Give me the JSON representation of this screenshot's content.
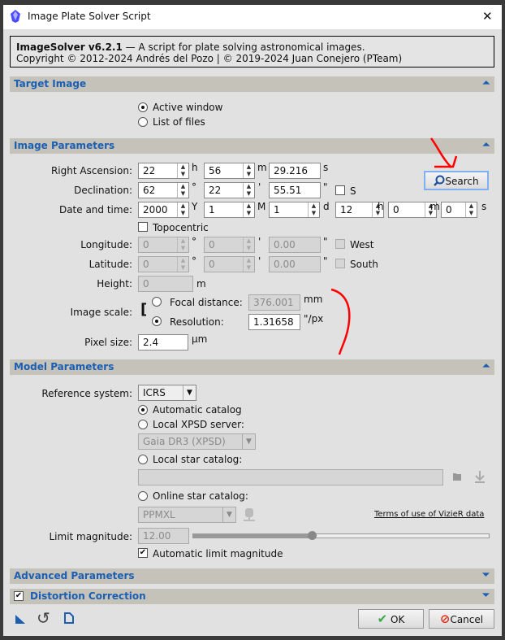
{
  "window": {
    "title": "Image Plate Solver Script",
    "close": "✕"
  },
  "header": {
    "app": "ImageSolver v6.2.1",
    "desc": " — A script for plate solving astronomical images.",
    "copyright": "Copyright © 2012-2024 Andrés del Pozo | © 2019-2024 Juan Conejero (PTeam)"
  },
  "target": {
    "title": "Target Image",
    "active": "Active window",
    "list": "List of files",
    "active_selected": true
  },
  "image": {
    "title": "Image Parameters",
    "ra": {
      "label": "Right Ascension:",
      "h": "22",
      "m": "56",
      "s": "29.216",
      "uh": "h",
      "um": "m",
      "us": "s"
    },
    "dec": {
      "label": "Declination:",
      "d": "62",
      "m": "22",
      "s": "55.51",
      "ud": "°",
      "um": "'",
      "us": "\"",
      "south": "S"
    },
    "date": {
      "label": "Date and time:",
      "y": "2000",
      "mo": "1",
      "d": "1",
      "h": "12",
      "mi": "0",
      "s": "0",
      "uy": "Y",
      "umo": "M",
      "ud": "d",
      "uh": "h",
      "umi": "m",
      "us": "s"
    },
    "topocentric": "Topocentric",
    "lon": {
      "label": "Longitude:",
      "d": "0",
      "m": "0",
      "s": "0.00",
      "west": "West"
    },
    "lat": {
      "label": "Latitude:",
      "d": "0",
      "m": "0",
      "s": "0.00",
      "south": "South"
    },
    "height": {
      "label": "Height:",
      "value": "0",
      "unit": "m"
    },
    "scale": {
      "label": "Image scale:",
      "focal_label": "Focal distance:",
      "focal": "376.001",
      "focal_unit": "mm",
      "res_label": "Resolution:",
      "res": "1.31658",
      "res_unit": "\"/px",
      "selected": "resolution"
    },
    "pixel": {
      "label": "Pixel size:",
      "value": "2.4",
      "unit": "µm"
    },
    "search": "Search"
  },
  "model": {
    "title": "Model Parameters",
    "ref_label": "Reference system:",
    "ref": "ICRS",
    "auto": "Automatic catalog",
    "xpsd": "Local XPSD server:",
    "xpsd_value": "Gaia DR3 (XPSD)",
    "local": "Local star catalog:",
    "local_value": "",
    "online": "Online star catalog:",
    "online_value": "PPMXL",
    "terms": "Terms of use of VizieR data",
    "limit_label": "Limit magnitude:",
    "limit": "12.00",
    "limit_slider": 0.4,
    "auto_limit": "Automatic limit magnitude",
    "auto_limit_checked": true
  },
  "advanced": {
    "title": "Advanced Parameters"
  },
  "distortion": {
    "title": "Distortion Correction",
    "checked": true
  },
  "footer": {
    "ok": "OK",
    "cancel": "Cancel"
  },
  "colors": {
    "section_text": "#1a5fb4",
    "section_bg": "#c5c2ba",
    "annotation": "#ff0000"
  }
}
